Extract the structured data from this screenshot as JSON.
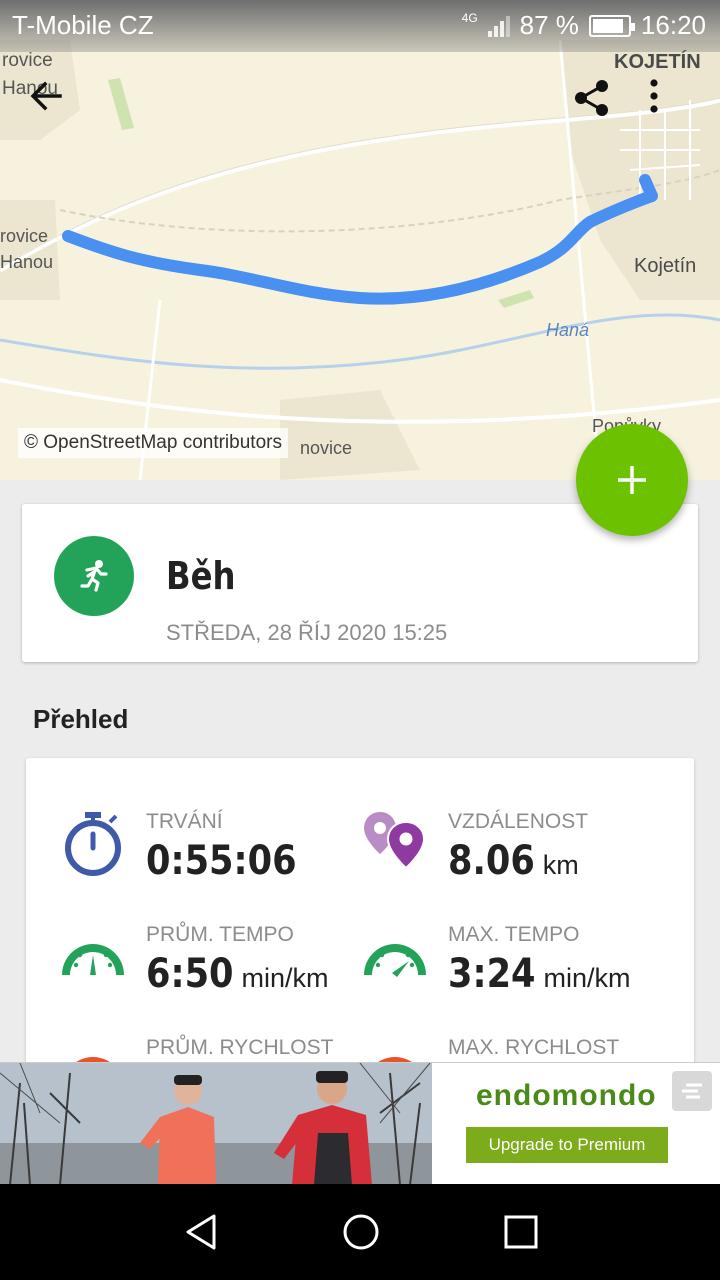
{
  "status_bar": {
    "carrier": "T-Mobile CZ",
    "network": "4G",
    "battery_percent": "87 %",
    "battery_level": 0.87,
    "time": "16:20"
  },
  "map": {
    "labels": {
      "town_top_right": "KOJETÍN",
      "town_right": "Kojetín",
      "village_top_left_1": "rovice",
      "village_top_left_2": "Hanou",
      "village_left_1": "rovice",
      "village_left_2": "Hanou",
      "river": "Haná",
      "village_bottom_right": "Popůvky",
      "village_bottom": "novice"
    },
    "credit": "© OpenStreetMap contributors",
    "route_color": "#4a90f0"
  },
  "toolbar": {
    "back_icon": "arrow-left-icon",
    "share_icon": "share-icon",
    "more_icon": "more-vertical-icon"
  },
  "fab": {
    "icon": "plus-icon",
    "color": "#6cc200"
  },
  "activity": {
    "title": "Běh",
    "date": "STŘEDA, 28 ŘÍJ 2020 15:25",
    "icon": "running-icon",
    "color": "#23a35a"
  },
  "overview": {
    "title": "Přehled",
    "stats": [
      {
        "label": "TRVÁNÍ",
        "value": "0:55:06",
        "unit": "",
        "icon": "stopwatch-icon",
        "color": "#3f5aa8"
      },
      {
        "label": "VZDÁLENOST",
        "value": "8.06",
        "unit": "km",
        "icon": "location-pins-icon",
        "color": "#8e3aa0"
      },
      {
        "label": "PRŮM. TEMPO",
        "value": "6:50",
        "unit": "min/km",
        "icon": "gauge-icon",
        "color": "#23a35a"
      },
      {
        "label": "MAX. TEMPO",
        "value": "3:24",
        "unit": "min/km",
        "icon": "gauge-icon",
        "color": "#23a35a"
      },
      {
        "label": "PRŮM. RYCHLOST",
        "value": "",
        "unit": "",
        "icon": "speed-icon",
        "color": "#e8542a"
      },
      {
        "label": "MAX. RYCHLOST",
        "value": "",
        "unit": "",
        "icon": "speed-icon",
        "color": "#e8542a"
      }
    ]
  },
  "ad": {
    "brand": "endomondo",
    "cta": "Upgrade to Premium"
  },
  "navbar": {
    "back_icon": "nav-back-icon",
    "home_icon": "nav-home-icon",
    "recents_icon": "nav-recents-icon"
  }
}
